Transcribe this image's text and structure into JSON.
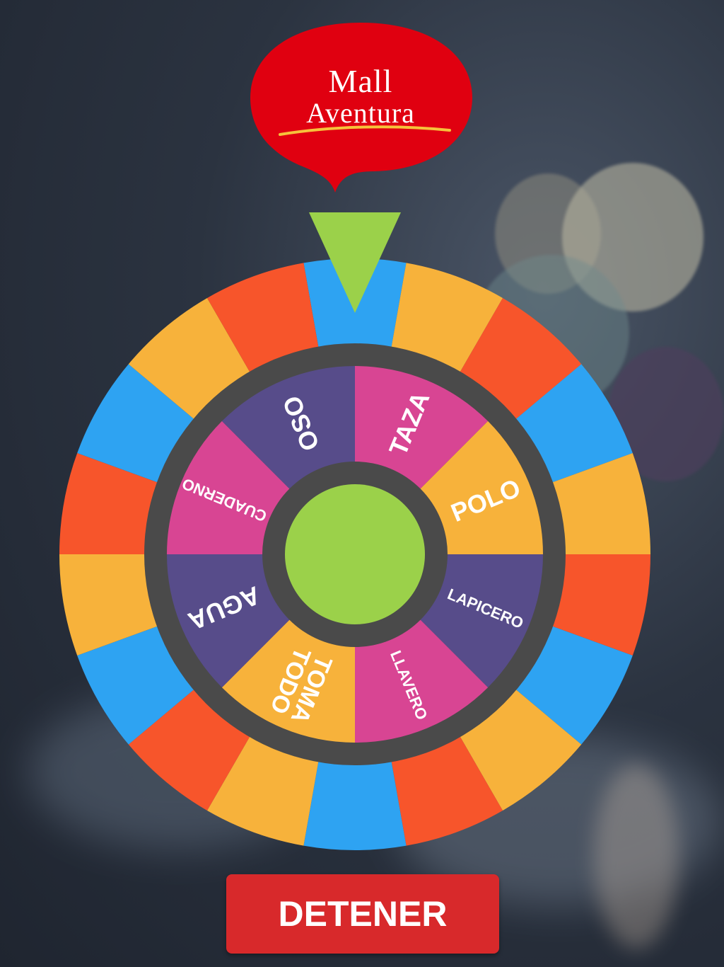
{
  "logo": {
    "line1": "Mall",
    "line2": "Aventura",
    "color": "#e00010"
  },
  "colors": {
    "blue": "#2ea3f2",
    "orange": "#f7b23b",
    "red": "#f7552b",
    "purple": "#574c8a",
    "pink": "#d84593",
    "ring": "#4a4a4a",
    "hub": "#9bd14a",
    "pointer": "#9bd14a"
  },
  "outer_ring": [
    "blue",
    "orange",
    "red",
    "blue",
    "orange",
    "red",
    "blue",
    "orange",
    "red",
    "blue",
    "orange",
    "red",
    "blue",
    "orange",
    "red",
    "blue",
    "orange",
    "red"
  ],
  "prizes": [
    {
      "label": "TAZA",
      "color": "pink"
    },
    {
      "label": "POLO",
      "color": "orange"
    },
    {
      "label": "LAPICERO",
      "color": "purple"
    },
    {
      "label": "LLAVERO",
      "color": "pink"
    },
    {
      "label": "TOMA TODO",
      "color": "orange"
    },
    {
      "label": "AGUA",
      "color": "purple"
    },
    {
      "label": "CUADERNO",
      "color": "pink"
    },
    {
      "label": "OSO",
      "color": "purple"
    }
  ],
  "stop_button": {
    "label": "DETENER"
  }
}
